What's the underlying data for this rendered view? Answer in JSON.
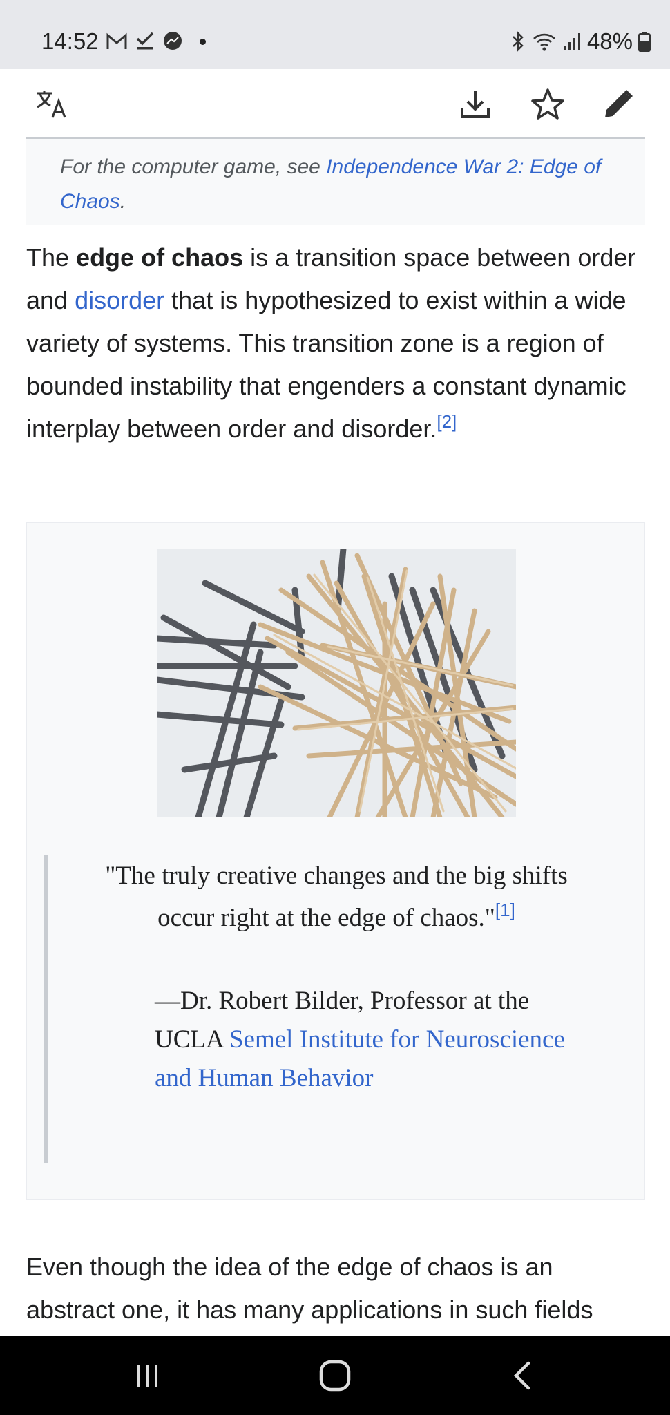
{
  "status_bar": {
    "time": "14:52",
    "battery": "48%",
    "notification_icons": [
      "gmail-icon",
      "check-icon",
      "messenger-icon"
    ],
    "system_icons": [
      "bluetooth-icon",
      "wifi-icon",
      "signal-icon",
      "battery-icon"
    ]
  },
  "toolbar": {
    "icons": [
      "translate-icon",
      "download-icon",
      "star-icon",
      "edit-icon"
    ]
  },
  "hatnote": {
    "prefix": "For the computer game, see ",
    "link_line1": "Independence War 2: Edge of",
    "link_line2": "Chaos",
    "suffix": "."
  },
  "lead": {
    "the": "The ",
    "term": "edge of chaos",
    "part1": " is a transition space between order and ",
    "link": "disorder",
    "part2": " that is hypothesized to exist within a wide variety of systems. This transition zone is a region of bounded instability that engenders a constant dynamic interplay between order and disorder.",
    "ref": "[2]"
  },
  "figure": {
    "image_name": "sticks-photo",
    "quote_text": "\"The truly creative changes and the big shifts occur right at the edge of chaos.\"",
    "quote_ref": "[1]",
    "attribution_prefix": "—Dr. Robert Bilder, Professor at the UCLA ",
    "attribution_link": "Semel Institute for Neuroscience and Human Behavior"
  },
  "para2": {
    "text": "Even though the idea of the edge of chaos is an abstract one, it has many applications in such fields"
  },
  "navbar": {
    "icons": [
      "recent-apps-icon",
      "home-icon",
      "back-icon"
    ]
  },
  "colors": {
    "link": "#3366cc",
    "text": "#202122",
    "hatnote_bg": "#f8f9fa",
    "status_bg": "#e7e8ec"
  }
}
